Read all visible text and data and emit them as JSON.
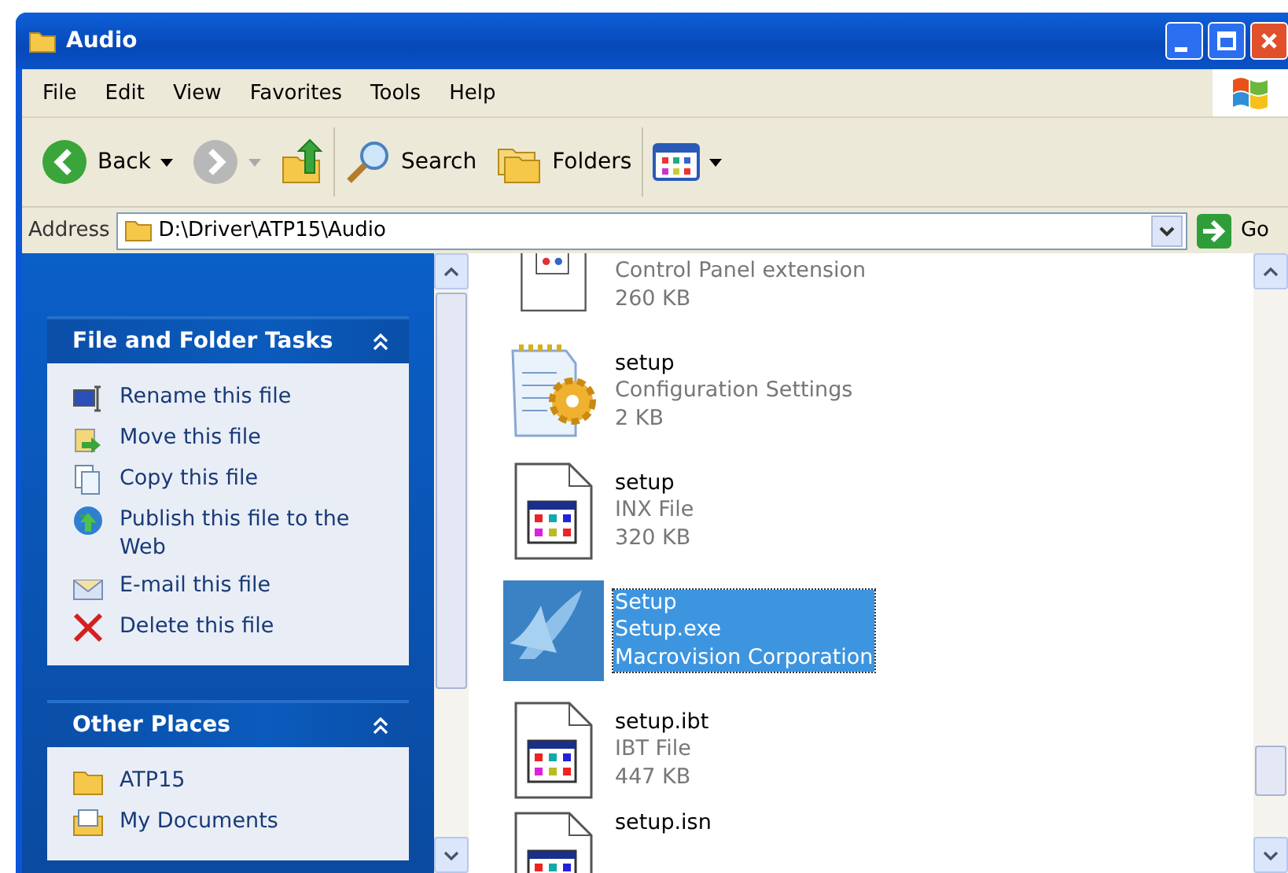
{
  "window": {
    "title": "Audio"
  },
  "menu": [
    "File",
    "Edit",
    "View",
    "Favorites",
    "Tools",
    "Help"
  ],
  "toolbar": [
    {
      "kind": "back",
      "label": "Back",
      "disabled": false
    },
    {
      "kind": "forward",
      "disabled": true
    },
    {
      "kind": "up"
    },
    {
      "kind": "search",
      "label": "Search"
    },
    {
      "kind": "folders",
      "label": "Folders"
    },
    {
      "kind": "views"
    }
  ],
  "address": {
    "label": "Address",
    "value": "D:\\Driver\\ATP15\\Audio",
    "go": "Go"
  },
  "task_panels": [
    {
      "title": "File and Folder Tasks",
      "expanded": true,
      "items": [
        {
          "kind": "rename",
          "label": "Rename this file"
        },
        {
          "kind": "move",
          "label": "Move this file"
        },
        {
          "kind": "copy",
          "label": "Copy this file"
        },
        {
          "kind": "publish",
          "label": "Publish this file to the Web"
        },
        {
          "kind": "email",
          "label": "E-mail this file"
        },
        {
          "kind": "delete",
          "label": "Delete this file"
        }
      ]
    },
    {
      "title": "Other Places",
      "expanded": true,
      "items": [
        {
          "kind": "folder",
          "label": "ATP15"
        },
        {
          "kind": "documents",
          "label": "My Documents"
        }
      ]
    }
  ],
  "files": [
    {
      "kind": "cpl",
      "details": [
        "Control Panel extension",
        "260 KB"
      ],
      "selected": false
    },
    {
      "kind": "config",
      "name": "setup",
      "details": [
        "Configuration Settings",
        "2 KB"
      ],
      "selected": false
    },
    {
      "kind": "appfile",
      "name": "setup",
      "details": [
        "INX File",
        "320 KB"
      ],
      "selected": false
    },
    {
      "kind": "installer",
      "name": "Setup",
      "details": [
        "Setup.exe",
        "Macrovision Corporation"
      ],
      "selected": true
    },
    {
      "kind": "appfile",
      "name": "setup.ibt",
      "details": [
        "IBT File",
        "447 KB"
      ],
      "selected": false
    },
    {
      "kind": "appfile",
      "name": "setup.isn",
      "selected": false
    }
  ]
}
